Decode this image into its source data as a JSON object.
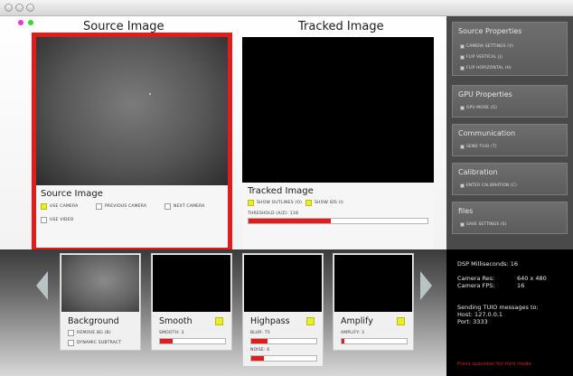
{
  "window": {
    "title": ""
  },
  "source": {
    "header": "Source Image",
    "panel_title": "Source Image",
    "options": [
      {
        "label": "USE CAMERA",
        "checked": true
      },
      {
        "label": "PREVIOUS CAMERA",
        "checked": false
      },
      {
        "label": "NEXT CAMERA",
        "checked": false
      },
      {
        "label": "USE VIDEO",
        "checked": false
      }
    ]
  },
  "tracked": {
    "header": "Tracked Image",
    "panel_title": "Tracked Image",
    "options": [
      {
        "label": "SHOW OUTLINES (O)",
        "checked": true
      },
      {
        "label": "SHOW IDS (I)",
        "checked": true
      }
    ],
    "threshold_label": "THRESHOLD (A/Z): 118",
    "threshold_level": 0.46
  },
  "sidebar": {
    "sections": [
      {
        "title": "Source Properties",
        "items": [
          "CAMERA SETTINGS (V)",
          "FLIP VERTICAL (J)",
          "FLIP HORIZONTAL (H)"
        ]
      },
      {
        "title": "GPU Properties",
        "items": [
          "GPU MODE (G)"
        ]
      },
      {
        "title": "Communication",
        "items": [
          "SEND TUIO (T)"
        ]
      },
      {
        "title": "Calibration",
        "items": [
          "ENTER CALIBRATION (C)"
        ]
      },
      {
        "title": "files",
        "items": [
          "SAVE SETTINGS (S)"
        ]
      }
    ]
  },
  "filters": [
    {
      "title": "Background",
      "image": "camera",
      "toggle": false,
      "options": [
        "REMOVE BG (B)",
        "DYNAMIC SUBTRACT"
      ],
      "sliders": []
    },
    {
      "title": "Smooth",
      "image": "black",
      "toggle": true,
      "options": [],
      "sliders": [
        {
          "label": "SMOOTH: 3",
          "level": 0.2
        }
      ]
    },
    {
      "title": "Highpass",
      "image": "black",
      "toggle": true,
      "options": [],
      "sliders": [
        {
          "label": "BLUR: 75",
          "level": 0.25
        },
        {
          "label": "NOISE: 6",
          "level": 0.2
        }
      ]
    },
    {
      "title": "Amplify",
      "image": "black",
      "toggle": true,
      "options": [],
      "sliders": [
        {
          "label": "AMPLIFY: 3",
          "level": 0.04
        }
      ]
    }
  ],
  "info": {
    "dsp": "DSP Milliseconds: 16",
    "camera_res_label": "Camera Res:",
    "camera_res_value": "640 x 480",
    "camera_fps_label": "Camera FPS:",
    "camera_fps_value": "16",
    "tuio_1": "Sending TUIO messages to:",
    "tuio_host": "Host: 127.0.0.1",
    "tuio_port": "Port: 3333",
    "warning": "Press spacebar for mini mode"
  },
  "colors": {
    "accent_red": "#e21b1b",
    "toggle_yellow": "#e8ee2a",
    "sidebar_bg": "#4a4a4a"
  }
}
